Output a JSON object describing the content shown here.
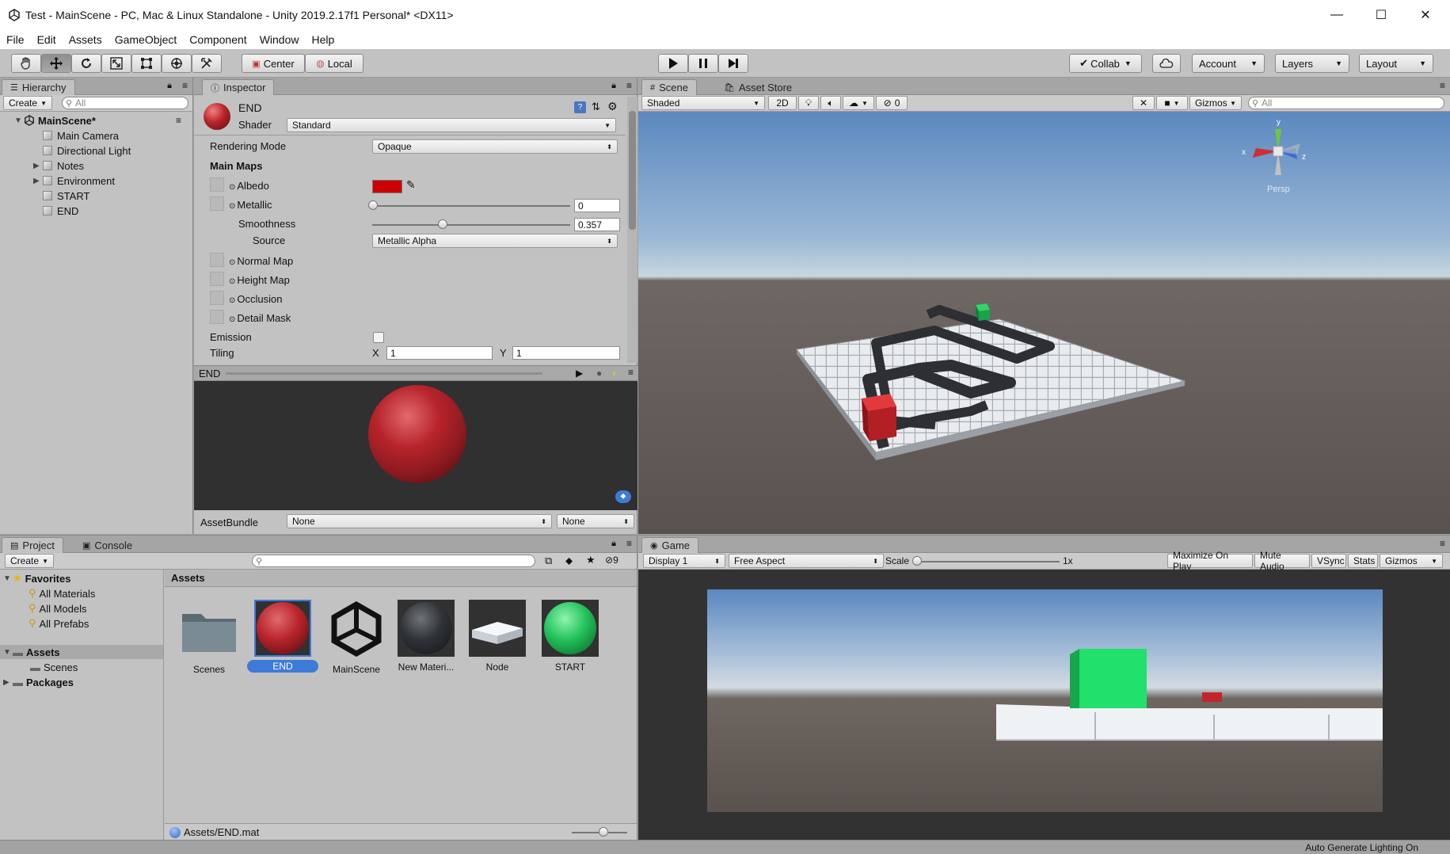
{
  "window": {
    "title": "Test - MainScene - PC, Mac & Linux Standalone - Unity 2019.2.17f1 Personal* <DX11>",
    "minimize": "—",
    "maximize": "☐",
    "close": "✕"
  },
  "menu": [
    "File",
    "Edit",
    "Assets",
    "GameObject",
    "Component",
    "Window",
    "Help"
  ],
  "toolbar": {
    "tools": [
      "hand-icon",
      "move-icon",
      "rotate-icon",
      "scale-icon",
      "rect-icon",
      "transform-icon",
      "custom-tool-icon"
    ],
    "pivot": "Center",
    "space": "Local",
    "collab": "Collab",
    "account": "Account",
    "layers": "Layers",
    "layout": "Layout"
  },
  "hierarchy": {
    "tab": "Hierarchy",
    "create": "Create",
    "search": "All",
    "scene": "MainScene*",
    "items": [
      {
        "label": "Main Camera",
        "expandable": false
      },
      {
        "label": "Directional Light",
        "expandable": false
      },
      {
        "label": "Notes",
        "expandable": true
      },
      {
        "label": "Environment",
        "expandable": true
      },
      {
        "label": "START",
        "expandable": false
      },
      {
        "label": "END",
        "expandable": false
      }
    ]
  },
  "inspector": {
    "tab": "Inspector",
    "name": "END",
    "shader_label": "Shader",
    "shader": "Standard",
    "rendering_mode_label": "Rendering Mode",
    "rendering_mode": "Opaque",
    "main_maps": "Main Maps",
    "albedo": "Albedo",
    "albedo_color": "#cc0000",
    "metallic": "Metallic",
    "metallic_value": "0",
    "metallic_level": 0,
    "smoothness": "Smoothness",
    "smoothness_value": "0.357",
    "smoothness_level": 0.357,
    "source_label": "Source",
    "source": "Metallic Alpha",
    "normal_map": "Normal Map",
    "height_map": "Height Map",
    "occlusion": "Occlusion",
    "detail_mask": "Detail Mask",
    "emission": "Emission",
    "tiling": "Tiling",
    "tiling_x_label": "X",
    "tiling_x": "1",
    "tiling_y_label": "Y",
    "tiling_y": "1",
    "preview_title": "END",
    "assetbundle_label": "AssetBundle",
    "assetbundle": "None",
    "assetbundle_variant": "None"
  },
  "scene": {
    "tabs": [
      "Scene",
      "Asset Store"
    ],
    "shading": "Shaded",
    "mode_2d": "2D",
    "hidden_count": "0",
    "gizmos": "Gizmos",
    "search": "All",
    "axis_x": "x",
    "axis_y": "y",
    "axis_z": "z",
    "persp": "Persp"
  },
  "project": {
    "tabs": [
      "Project",
      "Console"
    ],
    "create": "Create",
    "hidden_count": "9",
    "favorites": "Favorites",
    "favorite_items": [
      "All Materials",
      "All Models",
      "All Prefabs"
    ],
    "assets_folder": "Assets",
    "scenes_folder": "Scenes",
    "packages_folder": "Packages",
    "breadcrumb": "Assets",
    "assets": [
      {
        "label": "Scenes",
        "kind": "folder-icon"
      },
      {
        "label": "END",
        "kind": "material-red-icon"
      },
      {
        "label": "MainScene",
        "kind": "unity-scene-icon"
      },
      {
        "label": "New Materi...",
        "kind": "material-dark-icon"
      },
      {
        "label": "Node",
        "kind": "model-icon"
      },
      {
        "label": "START",
        "kind": "material-green-icon"
      }
    ],
    "selected_path": "Assets/END.mat"
  },
  "game": {
    "tab": "Game",
    "display": "Display 1",
    "aspect": "Free Aspect",
    "scale_label": "Scale",
    "scale_value": "1x",
    "maximize": "Maximize On Play",
    "mute": "Mute Audio",
    "vsync": "VSync",
    "stats": "Stats",
    "gizmos": "Gizmos"
  },
  "status": {
    "text": "Auto Generate Lighting On"
  },
  "colors": {
    "accent_selection": "#3d7bd8",
    "end_material": "#b8242b",
    "start_material": "#22c25a"
  }
}
